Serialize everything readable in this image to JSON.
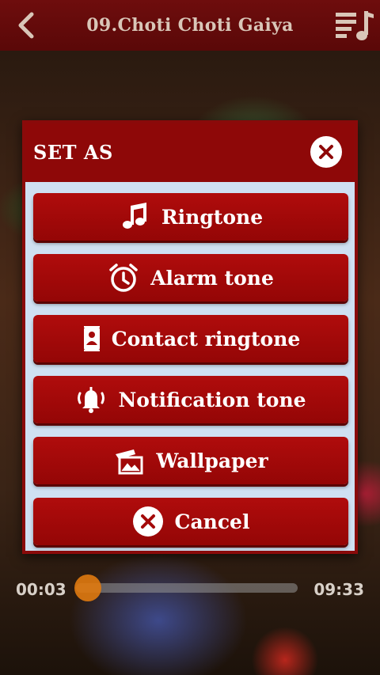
{
  "app": {
    "title": "09.Choti Choti Gaiya"
  },
  "player": {
    "current_time": "00:03",
    "total_time": "09:33",
    "progress": 0.005
  },
  "dialog": {
    "title": "SET AS",
    "options": [
      {
        "label": "Ringtone",
        "icon": "music-note-icon"
      },
      {
        "label": "Alarm tone",
        "icon": "alarm-clock-icon"
      },
      {
        "label": "Contact ringtone",
        "icon": "contact-card-icon"
      },
      {
        "label": "Notification tone",
        "icon": "bell-icon"
      },
      {
        "label": "Wallpaper",
        "icon": "image-icon"
      },
      {
        "label": "Cancel",
        "icon": "close-circle-icon"
      }
    ]
  },
  "colors": {
    "topbar": "#6e0d0d",
    "dialog_header": "#8e0808",
    "button": "#a40a0a",
    "dialog_body": "#cfe0f2",
    "seek_thumb": "#e07a10"
  }
}
